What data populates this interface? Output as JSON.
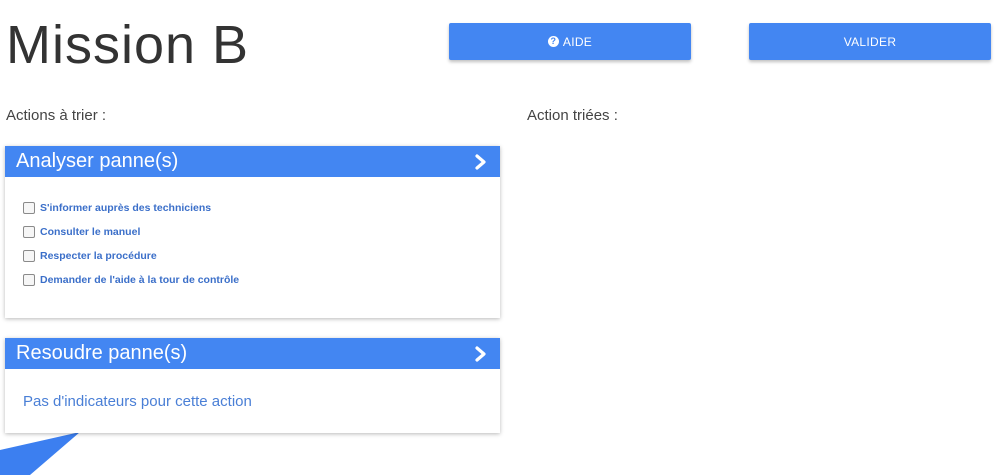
{
  "header": {
    "title": "Mission B",
    "help_button_label": "AIDE",
    "help_icon": "question-circle-icon",
    "validate_button_label": "VALIDER"
  },
  "labels": {
    "to_sort": "Actions à trier :",
    "sorted": "Action triées :"
  },
  "cards": [
    {
      "title": "Analyser panne(s)",
      "icon": "chevron-right-icon",
      "items": [
        {
          "label": "S'informer auprès des techniciens",
          "checked": false
        },
        {
          "label": "Consulter le manuel",
          "checked": false
        },
        {
          "label": "Respecter la procédure",
          "checked": false
        },
        {
          "label": "Demander de l'aide à la tour de contrôle",
          "checked": false
        }
      ]
    },
    {
      "title": "Resoudre panne(s)",
      "icon": "chevron-right-icon",
      "empty_text": "Pas d'indicateurs pour cette action"
    }
  ],
  "colors": {
    "accent": "#4386f2",
    "link_text": "#3b6fc9",
    "decor": "#3c7ff0"
  }
}
